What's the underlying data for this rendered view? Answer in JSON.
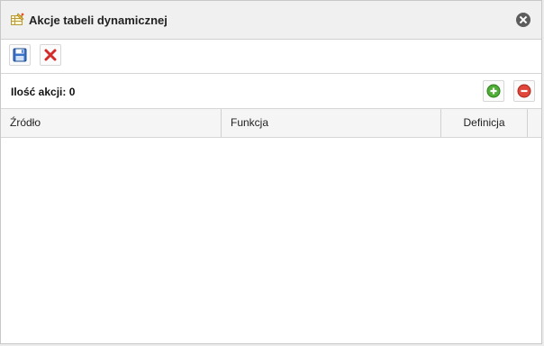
{
  "dialog": {
    "title": "Akcje tabeli dynamicznej",
    "title_icon": "table-actions-icon",
    "close_icon": "close-icon"
  },
  "toolbar": {
    "save_icon": "floppy-disk-icon",
    "cancel_icon": "red-x-icon"
  },
  "actions": {
    "count_label": "Ilość akcji: 0",
    "add_icon": "green-plus-icon",
    "remove_icon": "red-minus-icon"
  },
  "grid": {
    "columns": [
      "Źródło",
      "Funkcja",
      "Definicja"
    ],
    "rows": []
  },
  "colors": {
    "titlebar_bg": "#f0f0f0",
    "header_bg": "#f5f5f5",
    "border": "#d6d6d6"
  }
}
